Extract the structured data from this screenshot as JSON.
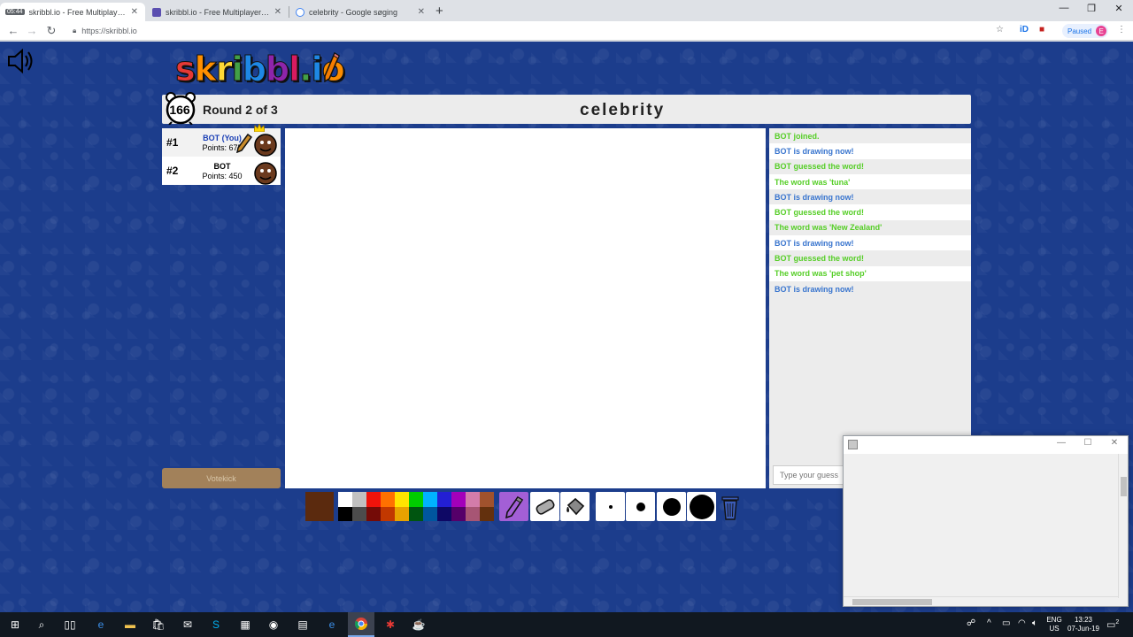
{
  "browser": {
    "tabs": [
      {
        "title": "skribbl.io - Free Multiplayer Draw",
        "badge": "05:44",
        "active": true
      },
      {
        "title": "skribbl.io - Free Multiplayer Draw",
        "active": false
      },
      {
        "title": "celebrity - Google søging",
        "active": false
      }
    ],
    "url": "https://skribbl.io",
    "paused_label": "Paused",
    "profile_initial": "E"
  },
  "game": {
    "logo": "skribbl.io",
    "timer": "166",
    "round_text": "Round 2 of 3",
    "word": "celebrity",
    "players": [
      {
        "rank": "#1",
        "name": "BOT (You)",
        "points": "Points: 675",
        "is_you": true,
        "drawing": true
      },
      {
        "rank": "#2",
        "name": "BOT",
        "points": "Points: 450",
        "is_you": false,
        "drawing": false
      }
    ],
    "votekick_label": "Votekick",
    "chat": [
      {
        "text": "BOT joined.",
        "type": "green"
      },
      {
        "text": "BOT is drawing now!",
        "type": "blue"
      },
      {
        "text": "BOT guessed the word!",
        "type": "green"
      },
      {
        "text": "The word was 'tuna'",
        "type": "green"
      },
      {
        "text": "BOT is drawing now!",
        "type": "blue"
      },
      {
        "text": "BOT guessed the word!",
        "type": "green"
      },
      {
        "text": "The word was 'New Zealand'",
        "type": "green"
      },
      {
        "text": "BOT is drawing now!",
        "type": "blue"
      },
      {
        "text": "BOT guessed the word!",
        "type": "green"
      },
      {
        "text": "The word was 'pet shop'",
        "type": "green"
      },
      {
        "text": "BOT is drawing now!",
        "type": "blue"
      }
    ],
    "guess_placeholder": "Type your guess",
    "current_color": "#5b2a0e",
    "palette_top": [
      "#ffffff",
      "#c1c1c1",
      "#ef130b",
      "#ff7100",
      "#ffe400",
      "#00cc00",
      "#00b2ff",
      "#231fd3",
      "#a300ba",
      "#d37caa",
      "#a0522d"
    ],
    "palette_bottom": [
      "#000000",
      "#4c4c4c",
      "#740b07",
      "#c23800",
      "#e8a200",
      "#005510",
      "#00569e",
      "#0e0865",
      "#550069",
      "#a75574",
      "#63300d"
    ],
    "tools": [
      "pencil-icon",
      "eraser-icon",
      "fill-bucket-icon"
    ],
    "brush_sizes": [
      "small",
      "medium",
      "large",
      "xlarge"
    ]
  },
  "colors": {
    "chat_green": "#56ce27",
    "chat_blue": "#3975ce",
    "page_bg": "#1c3d8c",
    "logo_letters": [
      "#e53935",
      "#ff8f00",
      "#fdd835",
      "#43a047",
      "#1e88e5",
      "#8e24aa",
      "#d81b60",
      "#43a047",
      "#1e88e5",
      "#fb8c00"
    ]
  },
  "taskbar": {
    "lang_top": "ENG",
    "lang_bottom": "US",
    "time": "13:23",
    "date": "07-Jun-19",
    "notification_count": "2"
  }
}
